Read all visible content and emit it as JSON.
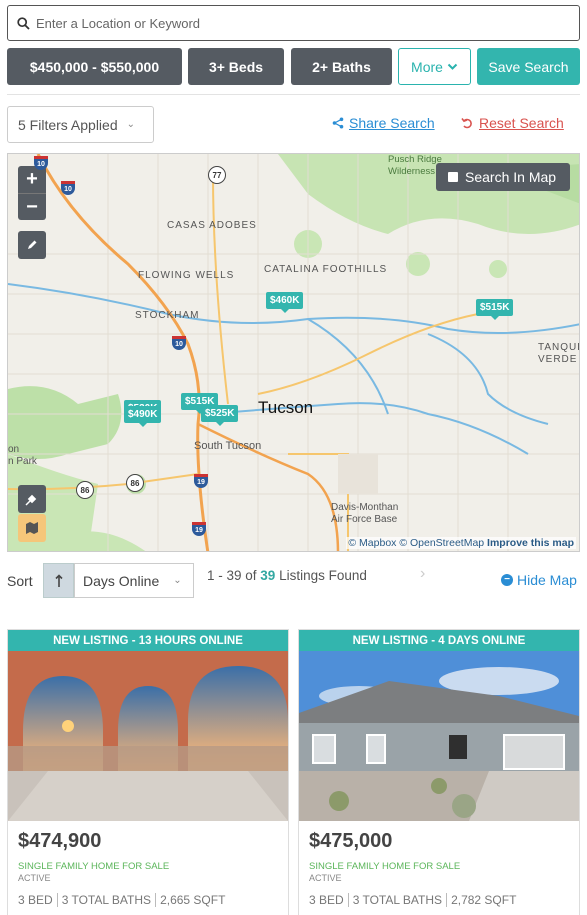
{
  "search": {
    "placeholder": "Enter a Location or Keyword"
  },
  "filters": {
    "price": "$450,000 - $550,000",
    "beds": "3+ Beds",
    "baths": "2+ Baths",
    "more": "More",
    "save": "Save Search"
  },
  "toolbar": {
    "filters_applied": "5 Filters Applied",
    "share": "Share Search",
    "reset": "Reset Search"
  },
  "map": {
    "search_in_map": "Search In Map",
    "city": "Tucson",
    "labels": [
      "CASAS ADOBES",
      "FLOWING WELLS",
      "STOCKHAM",
      "CATALINA FOOTHILLS",
      "TANQUE VERDE",
      "South Tucson",
      "Davis-Monthan Air Force Base",
      "Pusch Ridge Wilderness",
      "on",
      "n Park"
    ],
    "pins": [
      "$460K",
      "$515K",
      "$490K",
      "$515K",
      "$525K",
      "$530K"
    ],
    "highways": [
      "10",
      "77",
      "10",
      "19",
      "19",
      "86"
    ],
    "attribution": {
      "mapbox": "© Mapbox",
      "osm": "© OpenStreetMap",
      "improve": "Improve this map"
    }
  },
  "sort": {
    "label": "Sort",
    "value": "Days Online",
    "results_range": "1 - 39 of ",
    "results_count": "39",
    "results_suffix": " Listings Found",
    "hide_map": "Hide Map"
  },
  "listings": [
    {
      "banner": "NEW LISTING - 13 HOURS ONLINE",
      "price": "$474,900",
      "type": "SINGLE FAMILY HOME FOR SALE",
      "status": "ACTIVE",
      "beds": "3 BED",
      "baths": "3 TOTAL BATHS",
      "sqft": "2,665 SQFT"
    },
    {
      "banner": "NEW LISTING - 4 DAYS ONLINE",
      "price": "$475,000",
      "type": "SINGLE FAMILY HOME FOR SALE",
      "status": "ACTIVE",
      "beds": "3 BED",
      "baths": "3 TOTAL BATHS",
      "sqft": "2,782 SQFT"
    }
  ],
  "colors": {
    "accent": "#33b5ae",
    "dark": "#555b62",
    "link": "#2a8dd4",
    "danger": "#d9534f"
  }
}
